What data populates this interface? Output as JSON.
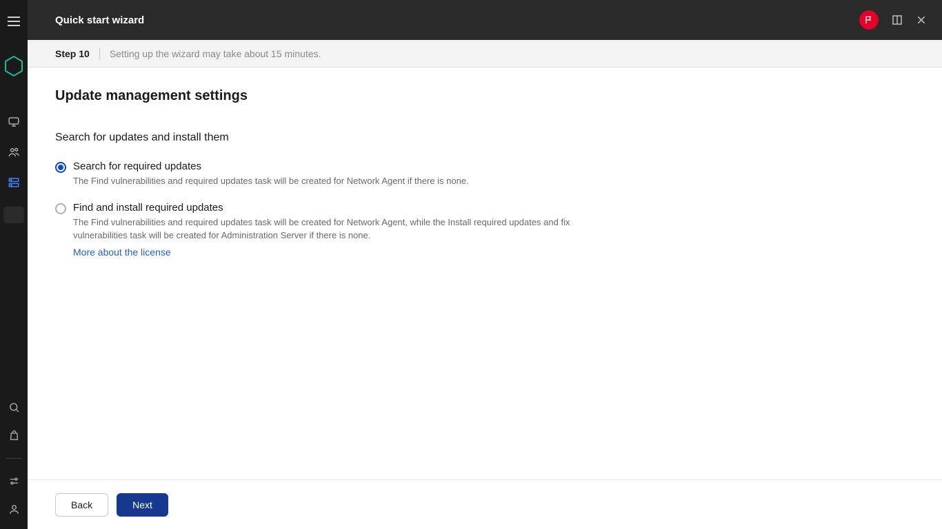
{
  "header": {
    "title": "Quick start wizard"
  },
  "step": {
    "label": "Step 10",
    "hint": "Setting up the wizard may take about 15 minutes."
  },
  "page": {
    "heading": "Update management settings",
    "subheading": "Search for updates and install them"
  },
  "options": [
    {
      "title": "Search for required updates",
      "description": "The Find vulnerabilities and required updates task will be created for Network Agent if there is none.",
      "selected": true
    },
    {
      "title": "Find and install required updates",
      "description": "The Find vulnerabilities and required updates task will be created for Network Agent, while the Install required updates and fix vulnerabilities task will be created for Administration Server if there is none.",
      "selected": false,
      "link": "More about the license"
    }
  ],
  "footer": {
    "back": "Back",
    "next": "Next"
  }
}
